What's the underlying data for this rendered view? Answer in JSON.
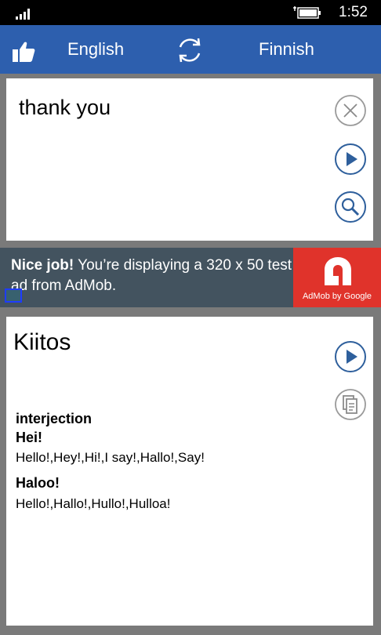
{
  "status": {
    "time": "1:52"
  },
  "header": {
    "source_lang": "English",
    "target_lang": "Finnish"
  },
  "input": {
    "text": "thank you"
  },
  "ad": {
    "bold": "Nice job!",
    "text": " You’re displaying a 320 x 50 test ad from AdMob.",
    "logo_label": "AdMob by Google"
  },
  "output": {
    "word": "Kiitos",
    "part_of_speech": "interjection",
    "entries": [
      {
        "word": "Hei!",
        "synonyms": "Hello!,Hey!,Hi!,I say!,Hallo!,Say!"
      },
      {
        "word": "Haloo!",
        "synonyms": "Hello!,Hallo!,Hullo!,Hulloa!"
      }
    ]
  },
  "colors": {
    "header": "#2d5fae",
    "accent": "#2e5f9c",
    "ad": "#43535f",
    "ad_logo": "#e0332b"
  },
  "icons": [
    "signal-icon",
    "battery-icon",
    "thumbs-up-icon",
    "swap-icon",
    "clear-icon",
    "play-icon",
    "search-icon",
    "copy-icon",
    "info-icon"
  ]
}
